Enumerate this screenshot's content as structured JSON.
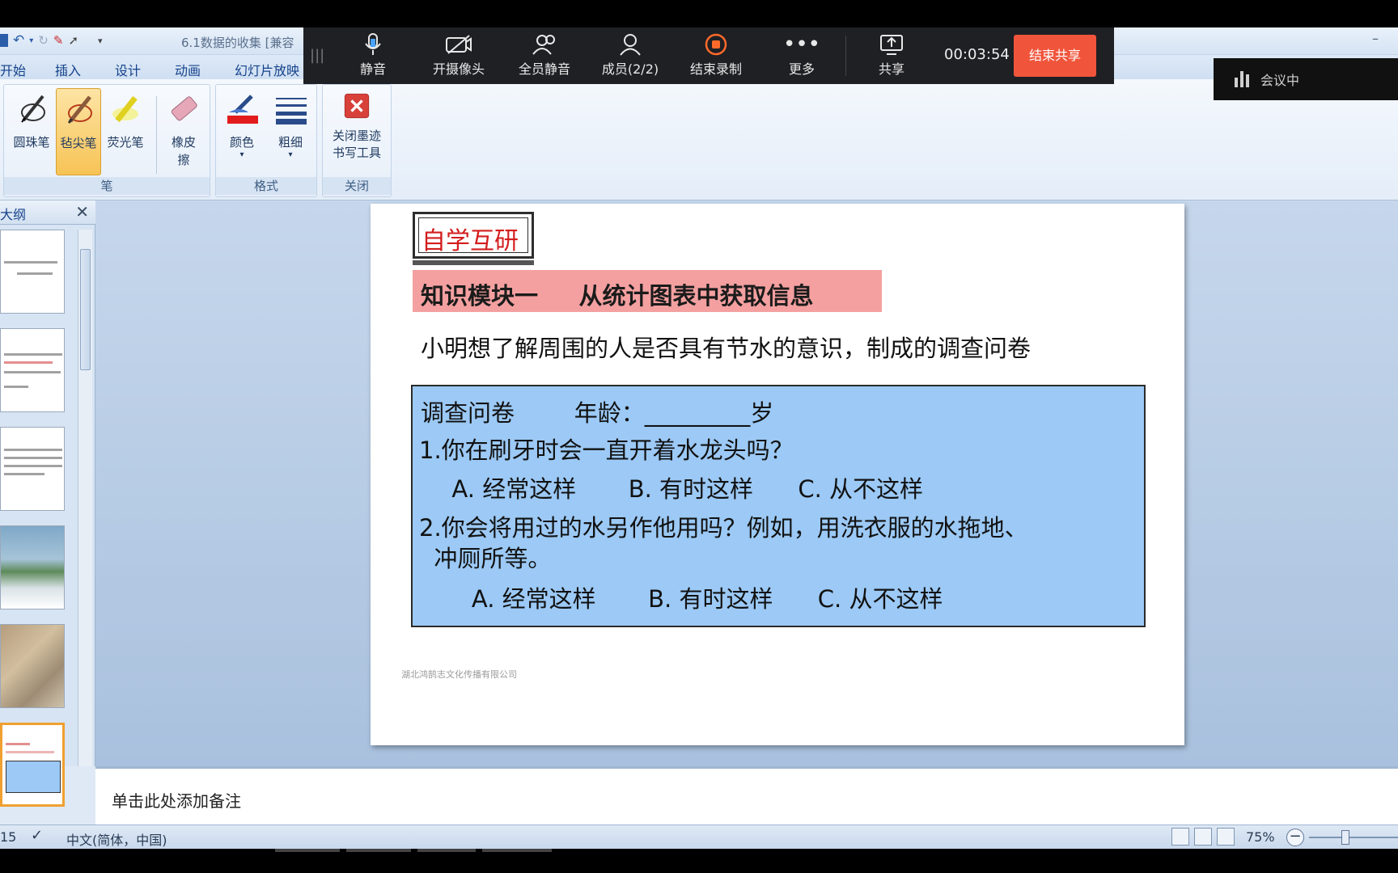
{
  "app": {
    "doc_title": "6.1数据的收集 [兼容",
    "minimize_symbol": "–"
  },
  "menu": {
    "items": [
      "开始",
      "插入",
      "设计",
      "动画",
      "幻灯片放映"
    ]
  },
  "ribbon": {
    "pen_group": {
      "label": "笔",
      "tools": [
        "圆珠笔",
        "毡尖笔",
        "荧光笔",
        "橡皮擦"
      ]
    },
    "format_group": {
      "label": "格式",
      "color_label": "颜色",
      "weight_label": "粗细"
    },
    "close_group": {
      "label": "关闭",
      "close_tool_line1": "关闭墨迹",
      "close_tool_line2": "书写工具"
    }
  },
  "meeting": {
    "buttons": [
      "静音",
      "开摄像头",
      "全员静音",
      "成员(2/2)",
      "结束录制",
      "更多",
      "共享"
    ],
    "timer": "00:03:54",
    "end_share": "结束共享",
    "status": "会议中",
    "rec_color": "#ff6a2b",
    "end_color": "#f0553c"
  },
  "left_pane": {
    "tab_label": "大纲",
    "close_symbol": "✕"
  },
  "slide": {
    "badge": "自学互研",
    "module_title": "知识模块一     从统计图表中获取信息",
    "intro": "小明想了解周围的人是否具有节水的意识，制成的调查问卷",
    "questionnaire": {
      "header": "调查问卷        年龄：_________岁",
      "q1": "1.你在刷牙时会一直开着水龙头吗？",
      "q1_options": "  A. 经常这样       B. 有时这样      C. 从不这样",
      "q2_line1": "2.你会将用过的水另作他用吗？例如，用洗衣服的水拖地、",
      "q2_line2": "  冲厕所等。",
      "q2_options": "    A. 经常这样       B. 有时这样      C. 从不这样"
    },
    "footer": "湖北鸿鹄志文化传播有限公司",
    "box_color": "#9cc9f5",
    "module_color": "#f4a0a0"
  },
  "notes": {
    "placeholder": "单击此处添加备注"
  },
  "status": {
    "page": "15",
    "language": "中文(简体，中国)",
    "zoom": "75%",
    "zoom_minus": "−"
  }
}
